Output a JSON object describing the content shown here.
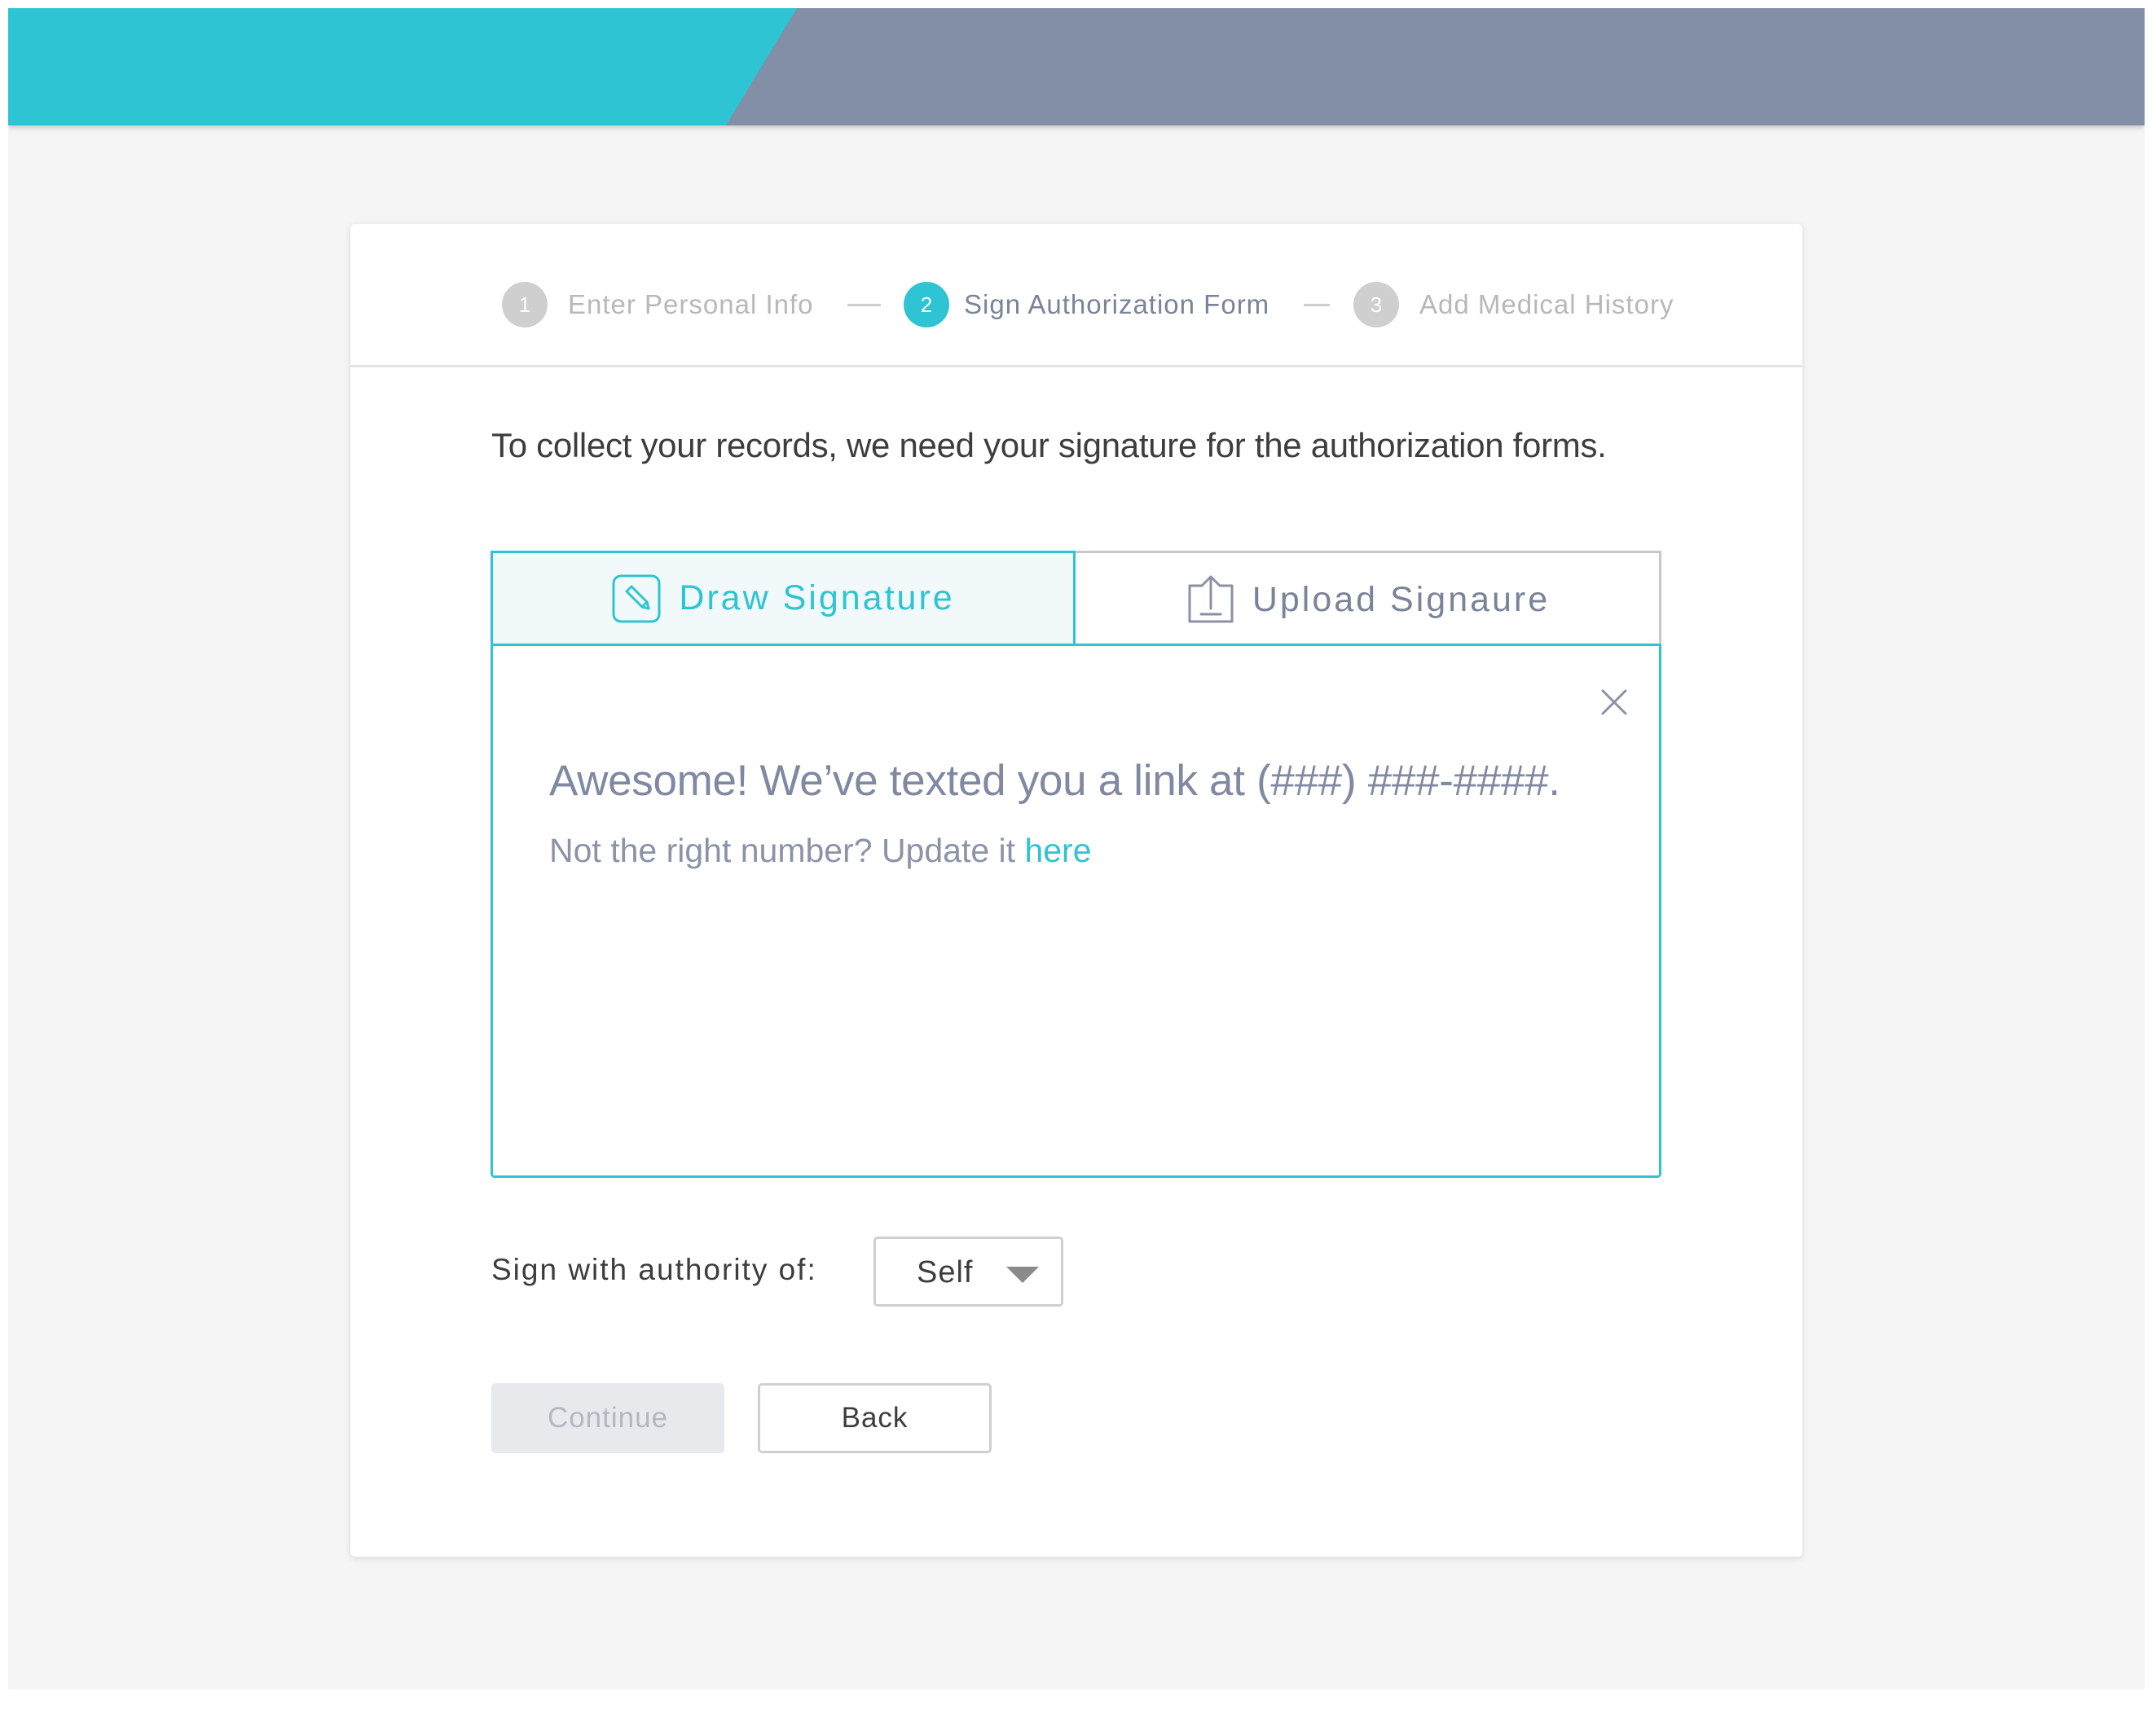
{
  "colors": {
    "accent": "#2ec4d3",
    "header_slate": "#838ea7",
    "page_background": "#f5f5f5",
    "muted_text": "#7a8498",
    "disabled_button": "#e8e9ed"
  },
  "stepper": {
    "steps": [
      {
        "number": "1",
        "label": "Enter Personal Info",
        "state": "inactive"
      },
      {
        "number": "2",
        "label": "Sign Authorization Form",
        "state": "active"
      },
      {
        "number": "3",
        "label": "Add Medical History",
        "state": "inactive"
      }
    ]
  },
  "intro_text": "To collect your records, we need your signature for the authorization forms.",
  "signature_tabs": {
    "draw": {
      "label": "Draw Signature",
      "icon": "draw-signature-icon",
      "selected": true
    },
    "upload": {
      "label": "Upload Signaure",
      "icon": "upload-icon",
      "selected": false
    }
  },
  "panel": {
    "close_icon": "close-icon",
    "message": "Awesome! We’ve texted you a link at (###) ###-####.",
    "sub_message_prefix": "Not the right number? Update it ",
    "sub_message_link": "here"
  },
  "authority": {
    "label": "Sign with authority of:",
    "selected_value": "Self",
    "caret_icon": "caret-down-icon"
  },
  "buttons": {
    "continue_label": "Continue",
    "continue_disabled": true,
    "back_label": "Back"
  }
}
